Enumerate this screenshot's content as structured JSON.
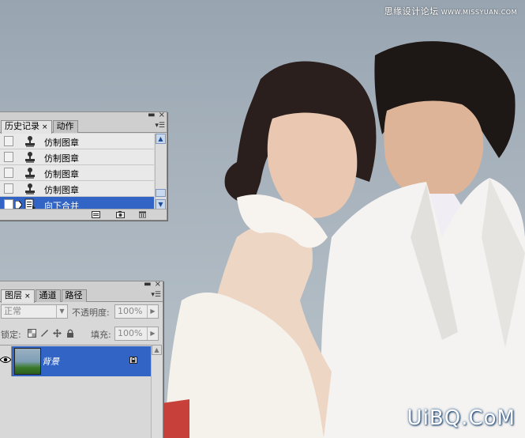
{
  "watermark_top": {
    "text": "思缘设计论坛",
    "site": "WWW.MISSYUAN.COM"
  },
  "watermark_bottom": "UiBQ.CoM",
  "history_panel": {
    "tabs": [
      {
        "label": "历史记录",
        "close": "×"
      },
      {
        "label": "动作"
      }
    ],
    "items": [
      {
        "label": "仿制图章",
        "icon": "stamp-icon",
        "selected": false
      },
      {
        "label": "仿制图章",
        "icon": "stamp-icon",
        "selected": false
      },
      {
        "label": "仿制图章",
        "icon": "stamp-icon",
        "selected": false
      },
      {
        "label": "仿制图章",
        "icon": "stamp-icon",
        "selected": false
      },
      {
        "label": "向下合并",
        "icon": "merge-icon",
        "selected": true
      }
    ],
    "footer_icons": [
      "new-document-icon",
      "new-snapshot-icon",
      "trash-icon"
    ]
  },
  "layers_panel": {
    "tabs": [
      {
        "label": "图层",
        "close": "×"
      },
      {
        "label": "通道"
      },
      {
        "label": "路径"
      }
    ],
    "blend_mode": "正常",
    "opacity_label": "不透明度:",
    "opacity_value": "100%",
    "lock_label": "锁定:",
    "fill_label": "填充:",
    "fill_value": "100%",
    "layers": [
      {
        "name": "背景",
        "visible": true,
        "locked": true
      }
    ]
  },
  "colors": {
    "selection": "#3164c4",
    "panel_bg": "#d8d8d8",
    "backdrop": "#a9b4bd"
  }
}
